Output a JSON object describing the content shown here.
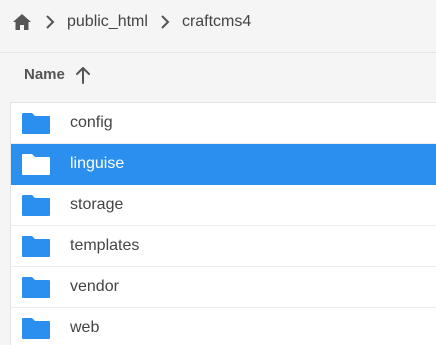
{
  "breadcrumb": {
    "items": [
      "public_html",
      "craftcms4"
    ]
  },
  "header": {
    "name_label": "Name",
    "sort": "ascending"
  },
  "files": [
    {
      "name": "config",
      "type": "folder",
      "selected": false
    },
    {
      "name": "linguise",
      "type": "folder",
      "selected": true
    },
    {
      "name": "storage",
      "type": "folder",
      "selected": false
    },
    {
      "name": "templates",
      "type": "folder",
      "selected": false
    },
    {
      "name": "vendor",
      "type": "folder",
      "selected": false
    },
    {
      "name": "web",
      "type": "folder",
      "selected": false
    }
  ],
  "colors": {
    "accent": "#2b8ff0",
    "folder": "#2b8ff0",
    "folder_selected": "#ffffff",
    "text": "#444444"
  }
}
